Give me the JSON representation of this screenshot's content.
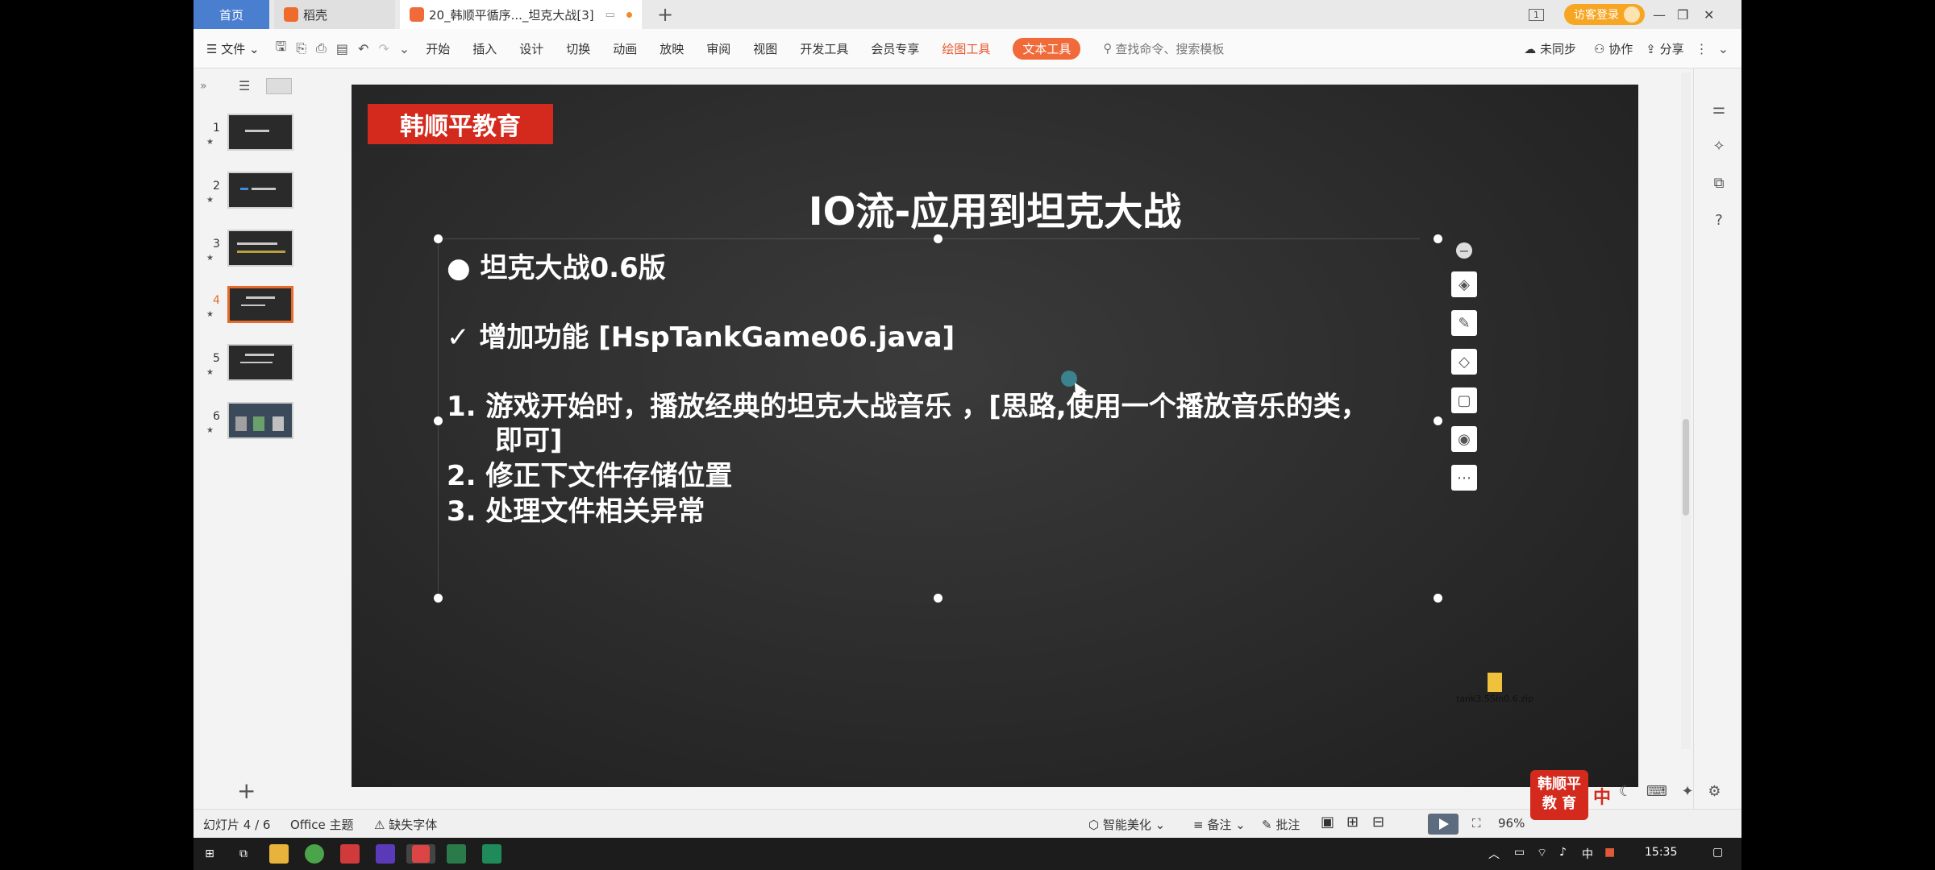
{
  "tabs": {
    "home": "首页",
    "daoke": "稻壳",
    "doc": "20_韩顺平循序..._坦克大战[3]",
    "add": "+"
  },
  "window": {
    "login": "访客登录",
    "page_badge": "1",
    "min": "—",
    "restore": "❐",
    "close": "✕"
  },
  "ribbon": {
    "file": "文件",
    "items": [
      "开始",
      "插入",
      "设计",
      "切换",
      "动画",
      "放映",
      "审阅",
      "视图",
      "开发工具",
      "会员专享"
    ],
    "drawing_tools": "绘图工具",
    "text_tools": "文本工具",
    "search_placeholder": "查找命令、搜索模板",
    "sync": "未同步",
    "collab": "协作",
    "share": "分享"
  },
  "thumbnails": [
    {
      "num": "1",
      "star": "★"
    },
    {
      "num": "2",
      "star": "★"
    },
    {
      "num": "3",
      "star": "★"
    },
    {
      "num": "4",
      "star": "★"
    },
    {
      "num": "5",
      "star": "★"
    },
    {
      "num": "6",
      "star": "★"
    }
  ],
  "slide": {
    "brand": "韩顺平教育",
    "title": "IO流-应用到坦克大战",
    "bullet": "坦克大战0.6版",
    "check": "增加功能 [HspTankGame06.java]",
    "items": [
      "1.  游戏开始时，播放经典的坦克大战音乐 ，[思路,使用一个播放音乐的类，",
      "即可]",
      "2.  修正下文件存储位置",
      "3.  处理文件相关异常"
    ],
    "zip_label": "tank3.5SIn0.6.zip"
  },
  "status": {
    "slide_count": "幻灯片 4 / 6",
    "theme": "Office 主题",
    "missing_font": "缺失字体",
    "beautify": "智能美化",
    "notes": "备注",
    "comments": "批注",
    "zoom": "96%"
  },
  "badge": {
    "line1": "韩顺平",
    "line2": "教 育"
  },
  "ime": "中",
  "taskbar": {
    "time": "15:35",
    "lang": "中"
  },
  "colors": {
    "accent": "#e56a2c",
    "brand_red": "#d42a1e",
    "home_tab": "#4a7fd0"
  }
}
